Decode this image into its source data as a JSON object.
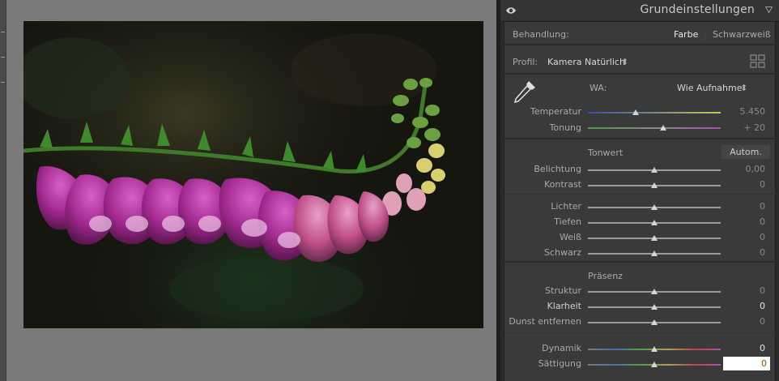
{
  "panel": {
    "title": "Grundeinstellungen",
    "treatment_label": "Behandlung:",
    "treatment_color": "Farbe",
    "treatment_bw": "Schwarzweiß",
    "profile_label": "Profil:",
    "profile_value": "Kamera Natürlich",
    "wb_label": "WA:",
    "wb_value": "Wie Aufnahme",
    "tone_title": "Tonwert",
    "auto_button": "Autom.",
    "presence_title": "Präsenz"
  },
  "sliders": {
    "temperature": {
      "label": "Temperatur",
      "value": "5.450",
      "position": 0.36
    },
    "tint": {
      "label": "Tonung",
      "value": "+ 20",
      "position": 0.57
    },
    "exposure": {
      "label": "Belichtung",
      "value": "0,00",
      "position": 0.5
    },
    "contrast": {
      "label": "Kontrast",
      "value": "0",
      "position": 0.5
    },
    "highlights": {
      "label": "Lichter",
      "value": "0",
      "position": 0.5
    },
    "shadows": {
      "label": "Tiefen",
      "value": "0",
      "position": 0.5
    },
    "whites": {
      "label": "Weiß",
      "value": "0",
      "position": 0.5
    },
    "blacks": {
      "label": "Schwarz",
      "value": "0",
      "position": 0.5
    },
    "texture": {
      "label": "Struktur",
      "value": "0",
      "position": 0.5
    },
    "clarity": {
      "label": "Klarheit",
      "value": "0",
      "position": 0.5
    },
    "dehaze": {
      "label": "Dunst entfernen",
      "value": "0",
      "position": 0.5
    },
    "vibrance": {
      "label": "Dynamik",
      "value": "0",
      "position": 0.5
    },
    "saturation": {
      "label": "Sättigung",
      "value": "0",
      "position": 0.5
    }
  },
  "icons": {
    "eye": "eye-icon",
    "collapse": "triangle-down-icon",
    "profile_browser": "grid-icon",
    "wb_picker": "eyedropper-icon"
  }
}
